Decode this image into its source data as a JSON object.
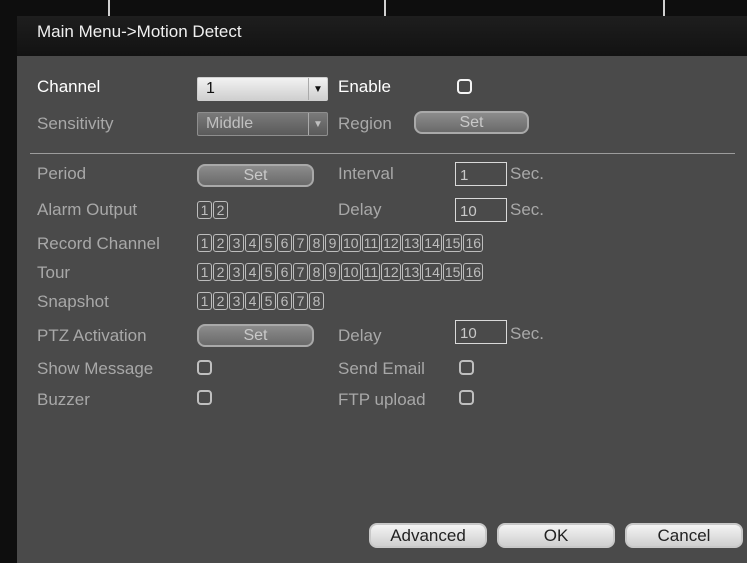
{
  "title": "Main Menu->Motion Detect",
  "channel": {
    "label": "Channel",
    "value": "1"
  },
  "enable": {
    "label": "Enable"
  },
  "sensitivity": {
    "label": "Sensitivity",
    "value": "Middle"
  },
  "region": {
    "label": "Region",
    "button": "Set"
  },
  "period": {
    "label": "Period",
    "button": "Set"
  },
  "interval": {
    "label": "Interval",
    "value": "1",
    "unit": "Sec."
  },
  "alarm_output": {
    "label": "Alarm Output",
    "items": [
      "1",
      "2"
    ]
  },
  "delay1": {
    "label": "Delay",
    "value": "10",
    "unit": "Sec."
  },
  "record_channel": {
    "label": "Record Channel",
    "items": [
      "1",
      "2",
      "3",
      "4",
      "5",
      "6",
      "7",
      "8",
      "9",
      "10",
      "11",
      "12",
      "13",
      "14",
      "15",
      "16"
    ]
  },
  "tour": {
    "label": "Tour",
    "items": [
      "1",
      "2",
      "3",
      "4",
      "5",
      "6",
      "7",
      "8",
      "9",
      "10",
      "11",
      "12",
      "13",
      "14",
      "15",
      "16"
    ]
  },
  "snapshot": {
    "label": "Snapshot",
    "items": [
      "1",
      "2",
      "3",
      "4",
      "5",
      "6",
      "7",
      "8"
    ]
  },
  "ptz": {
    "label": "PTZ Activation",
    "button": "Set"
  },
  "delay2": {
    "label": "Delay",
    "value": "10",
    "unit": "Sec."
  },
  "show_message": {
    "label": "Show Message"
  },
  "send_email": {
    "label": "Send Email"
  },
  "buzzer": {
    "label": "Buzzer"
  },
  "ftp": {
    "label": "FTP upload"
  },
  "footer": {
    "advanced": "Advanced",
    "ok": "OK",
    "cancel": "Cancel"
  }
}
